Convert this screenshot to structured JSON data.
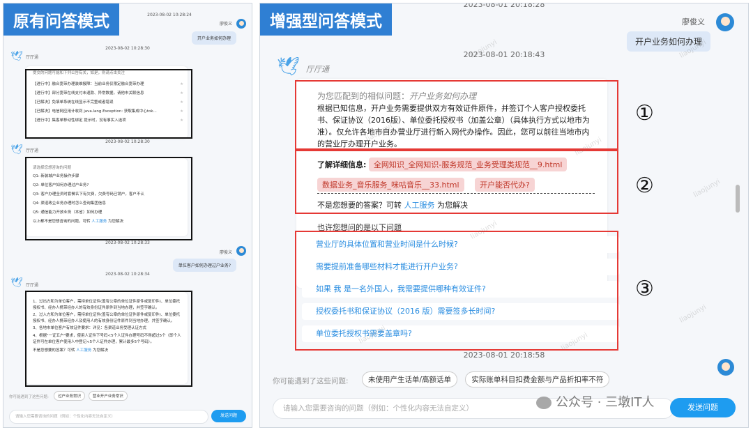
{
  "left": {
    "title": "原有问答模式",
    "timestamps": [
      "2023-08-02 10:28:24",
      "2023-08-02 10:28:30",
      "2023-08-02 10:28:30",
      "2023-08-02 10:28:33",
      "2023-08-02 10:28:34"
    ],
    "user_name": "廖俊义",
    "user_q1": "开户业务如何办理",
    "user_q2": "单位客户如何办理过户业务?",
    "bot_name": "厅厅通",
    "card1_title": "提交的问题可能和下列公告有关，如是，则请点击关注",
    "card1_items": [
      "【进行中】融合宽带办理装维报障：当前业务仅限定融合宽带办理",
      "【进行中】部分宽带在线支付未退款、异常数据，请他市关联信息",
      "【已解决】免填单系统在线显示不完整或者错误",
      "【已解决】电信网应用计收到 java.lang.Exception: 获取集成中心tok...",
      "【进行中】集客单移动性绑定 提示时，没有事实入选项"
    ],
    "card2_title": "请选择您想咨询的问题",
    "card2_items": [
      "Q1: 新装城户业务操作步骤",
      "Q2: 单位客户如何办理过户业务?",
      "Q3: 客户办理全员时套餐名下有欠费，欠费号码已销户，客户不认",
      "Q4: 渠道政企业务办理时怎么查询集团信息",
      "Q5: 通信能力开放业务（本省）如何办理"
    ],
    "card2_footer_pre": "以上都不是您想咨询的问题，可转",
    "card2_footer_link": "人工服务",
    "card2_footer_post": "为您解决",
    "card3_items": [
      "1、过出方和为单位客户，需持单位证件(盖有公章的单位证件原件或复印件)、单位委托授权书、经办人携带经办人的有效身份证件原件到当地办理，并签字确认。",
      "2、过入方和为单位客户，需持单位证件(盖有公章的单位证件原件或复印件)、单位委托授权书、经办人携带经办人及使用人的有效身份证件原件到当地办理，并签字确认。",
      "3、各地市单位客户有效证件要求：详见：各渠道业务受理认证方式",
      "4、根据\"一证五户\"要求，使用人证件下号码<5个人证件办理号码不得超过5个（即个人证件可在单位客户使用人中登记<5个人证件办理，累计最多5个号码）。"
    ],
    "card3_footer_pre": "不是您想要的答案？可转",
    "card3_footer_link": "人工服务",
    "card3_footer_post": "为您解决",
    "suggest_label": "你可能遇到了这些问题:",
    "suggest_tags": [
      "过户业务常识",
      "营业开户业务常识"
    ],
    "input_placeholder": "请输入您需要咨询的问题（例如：个性化内容无法自定义）",
    "send_label": "发送问题"
  },
  "right": {
    "title": "增强型问答模式",
    "top_ts": "2023-08-01 20:18:28",
    "user_name": "廖俊义",
    "user_q": "开户业务如何办理",
    "ts1": "2023-08-01 20:18:43",
    "bot_name": "厅厅通",
    "match_pre": "为您匹配到的相似问题：",
    "match_q": "开户业务如何办理",
    "answer": "根据已知信息，开户业务需要提供双方有效证件原件，并签订个人客户授权委托书、保证协议（2016版）、单位委托授权书（加盖公章）（具体执行方式以地市为准）。仅允许各地市自办营业厅进行新入网代办操作。因此，您可以前往当地市内的营业厅办理开户业务。",
    "detail_label": "了解详细信息:",
    "chips": [
      "全网知识_全网知识-服务规范_业务受理类规范__9.html",
      "数据业务_音乐服务_咪咕音乐__33.html",
      "开户能否代办?"
    ],
    "not_pre": "不是您想要的答案？可转",
    "not_link": "人工服务",
    "not_post": "为您解决",
    "also_label": "也许您想问的是以下问题",
    "suggestions": [
      "营业厅的具体位置和营业时间是什么时候?",
      "需要提前准备哪些材料才能进行开户业务?",
      "如果 我 是一名外国人，我需要提供哪种有效证件?",
      "授权委托书和保证协议（2016 版）需要签多长时间?",
      "单位委托授权书需要盖章吗?"
    ],
    "ts2": "2023-08-01 20:18:58",
    "circles": [
      "①",
      "②",
      "③"
    ],
    "bottom_label": "你可能遇到了这些问题:",
    "bottom_tags": [
      "未使用产生话单/高额话单",
      "实际账单科目扣费金额与产品折扣率不符"
    ],
    "input_placeholder": "请输入您需要咨询的问题（例如：个性化内容无法自定义）",
    "send_label": "发送问题",
    "watermark": "公众号 · 三墩IT人",
    "watermark_brand": "liaojunyi"
  },
  "colors": {
    "title_bg": "#2f7fd3",
    "red_box": "#e53935",
    "link": "#2a8de0",
    "chip_bg": "#f7d4d4",
    "send": "#1e9cf0"
  }
}
